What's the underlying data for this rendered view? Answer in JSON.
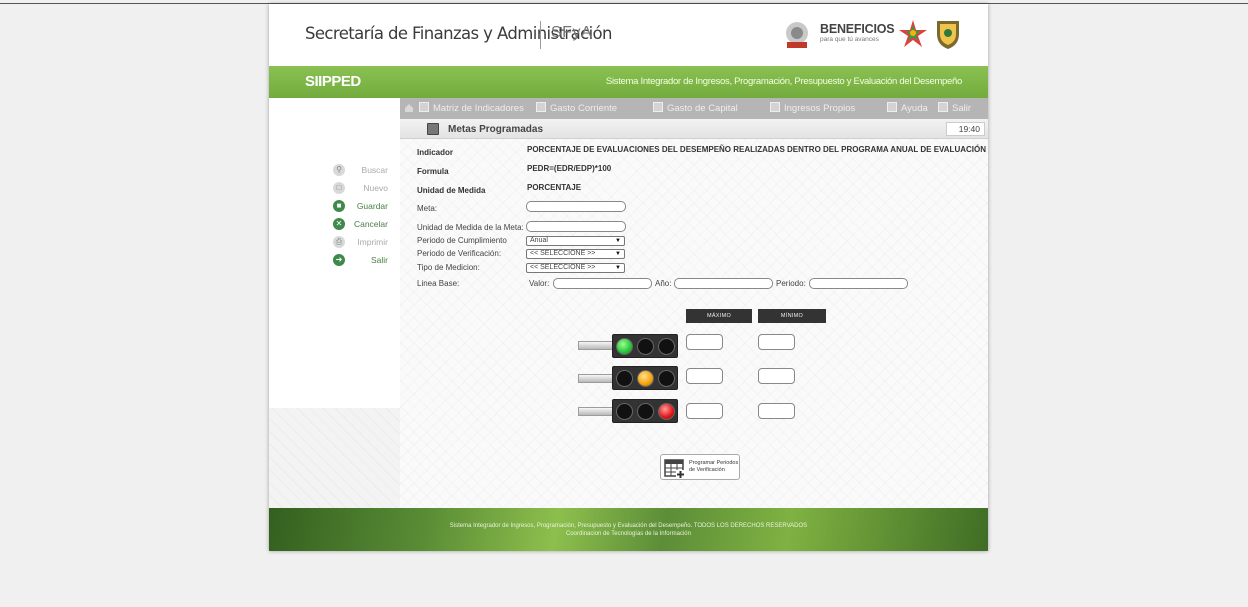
{
  "header": {
    "title": "Secretaría de Finanzas y Administración",
    "short": "SFyA",
    "beneficios": "BENEFICIOS",
    "beneficios_sub": "para que tú avances"
  },
  "app": {
    "name": "SIIPPED",
    "full_name": "Sistema Integrador de Ingresos, Programación, Presupuesto y Evaluación del Desempeño"
  },
  "nav": {
    "items": [
      "Matriz de Indicadores",
      "Gasto Corriente",
      "Gasto de Capital",
      "Ingresos Propios",
      "Ayuda",
      "Salir"
    ]
  },
  "section": {
    "title": "Metas Programadas",
    "time": "19:40"
  },
  "sidebar": {
    "items": [
      {
        "label": "Buscar",
        "icon": "search-icon",
        "enabled": false
      },
      {
        "label": "Nuevo",
        "icon": "document-icon",
        "enabled": false
      },
      {
        "label": "Guardar",
        "icon": "save-icon",
        "enabled": true
      },
      {
        "label": "Cancelar",
        "icon": "cancel-icon",
        "enabled": true
      },
      {
        "label": "Imprimir",
        "icon": "printer-icon",
        "enabled": false
      },
      {
        "label": "Salir",
        "icon": "exit-icon",
        "enabled": true
      }
    ]
  },
  "form": {
    "indicador_label": "Indicador",
    "indicador_value": "PORCENTAJE DE EVALUACIONES DEL DESEMPEÑO REALIZADAS DENTRO DEL PROGRAMA ANUAL DE EVALUACIÓN",
    "formula_label": "Formula",
    "formula_value": "PEDR=(EDR/EDP)*100",
    "unidad_label": "Unidad de Medida",
    "unidad_value": "PORCENTAJE",
    "meta_label": "Meta:",
    "unidad_meta_label": "Unidad de Medida de la Meta:",
    "periodo_cumplimiento_label": "Periodo de Cumplimiento",
    "periodo_cumplimiento_value": "Anual",
    "periodo_verificacion_label": "Periodo de Verificación:",
    "periodo_verificacion_value": "<< SELECCIONE >>",
    "tipo_medicion_label": "Tipo de Medicion:",
    "tipo_medicion_value": "<< SELECCIONE >>",
    "linea_base_label": "Linea Base:",
    "valor_label": "Valor:",
    "anio_label": "Año:",
    "periodo_label": "Periodo:"
  },
  "semaforo": {
    "max_label": "MÁXIMO",
    "min_label": "MÍNIMO",
    "colors": {
      "green": "#27c43b",
      "yellow": "#f5a20a",
      "red": "#e01616"
    }
  },
  "program_button": {
    "line1": "Programar Periodos",
    "line2": "de Verificación"
  },
  "footer": {
    "line1": "Sistema Integrador de Ingresos, Programación, Presupuesto y Evaluación del Desempeño. TODOS LOS DERECHOS RESERVADOS",
    "line2": "Coordinacion de Tecnologías de la Información"
  }
}
